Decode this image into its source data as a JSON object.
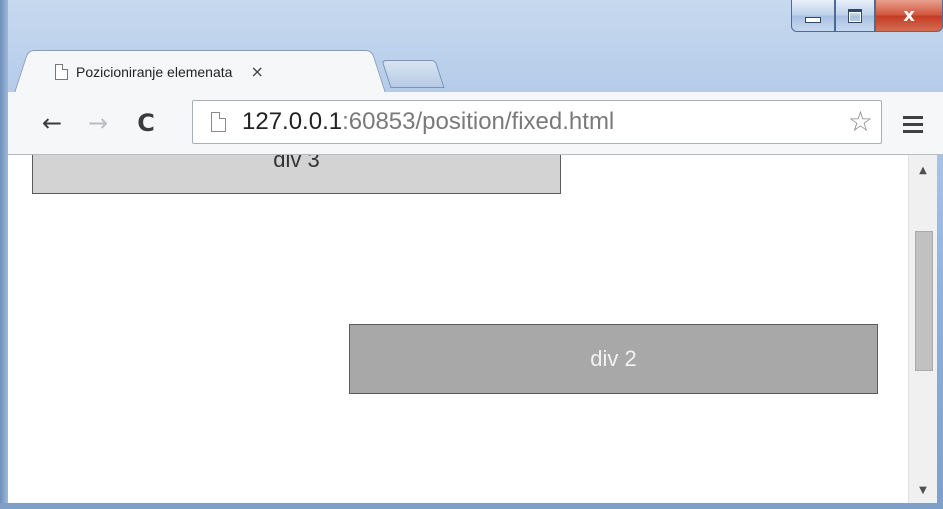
{
  "window": {
    "minimize_glyph": "minimize",
    "maximize_glyph": "maximize",
    "close_label": "x"
  },
  "tab": {
    "title": "Pozicioniranje elemenata",
    "close": "×"
  },
  "toolbar": {
    "back": "←",
    "forward": "→",
    "reload": "C",
    "url_host": "127.0.0.1",
    "url_path": ":60853/position/fixed.html",
    "bookmark_star": "☆"
  },
  "page": {
    "div3_label": "div 3",
    "div2_label": "div 2"
  },
  "scrollbar": {
    "up_arrow": "▲",
    "down_arrow": "▼"
  },
  "colors": {
    "div3_bg": "#d3d3d3",
    "div2_bg": "#a9a8a9",
    "close_button": "#c23b22"
  },
  "icons": [
    "page-icon",
    "star-icon",
    "menu-icon",
    "back-icon",
    "forward-icon",
    "reload-icon",
    "close-icon"
  ]
}
